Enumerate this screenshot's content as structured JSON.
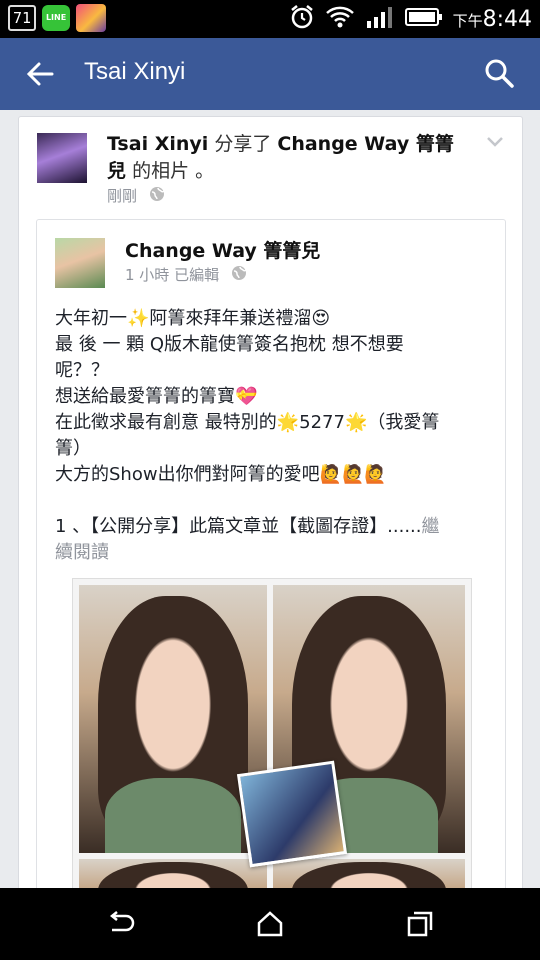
{
  "status_bar": {
    "notification_badge": "71",
    "line_app": "LINE",
    "time_prefix": "下午",
    "time": "8:44"
  },
  "app_bar": {
    "title": "Tsai Xinyi"
  },
  "post": {
    "author": "Tsai Xinyi",
    "action_prefix": "分享了",
    "shared_from": "Change Way  箐箐兒",
    "action_suffix": "的相片 。",
    "time": "剛剛"
  },
  "shared_post": {
    "author": "Change Way  箐箐兒",
    "time": "1 小時 已編輯",
    "lines": [
      "大年初一✨阿箐來拜年兼送禮溜😍",
      "最 後 一 顆 Q版木龍使箐簽名抱枕 想不想要",
      "呢？？",
      "想送給最愛箐箐的箐寶💝",
      "在此徵求最有創意 最特別的🌟5277🌟（我愛箐",
      "箐）",
      "大方的Show出你們對阿箐的愛吧🙋🙋🙋",
      "",
      "1 、【公開分享】此篇文章並【截圖存證】......"
    ],
    "see_more": "繼續閱讀",
    "see_more_first": "繼",
    "see_more_rest": "續閱讀"
  },
  "colors": {
    "brand": "#3b5998",
    "meta": "#90949c"
  },
  "icons": [
    "back-arrow-icon",
    "search-icon",
    "globe-icon",
    "chevron-down-icon",
    "back-nav-icon",
    "home-nav-icon",
    "recents-nav-icon",
    "alarm-icon",
    "wifi-icon",
    "signal-icon",
    "battery-icon"
  ]
}
